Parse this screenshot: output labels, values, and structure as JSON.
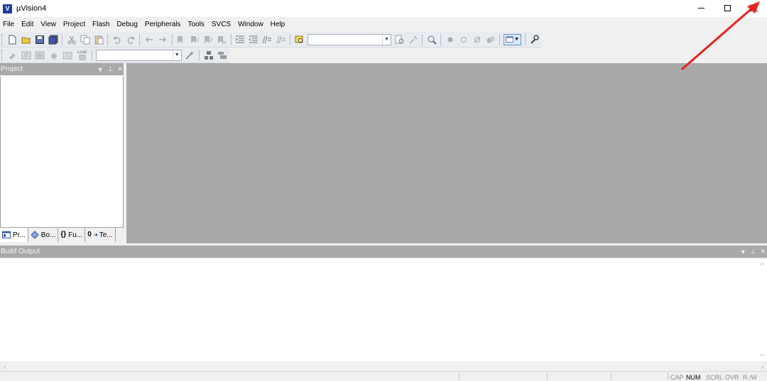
{
  "window": {
    "title": "µVision4",
    "app_icon_letter": "V"
  },
  "menu": [
    "File",
    "Edit",
    "View",
    "Project",
    "Flash",
    "Debug",
    "Peripherals",
    "Tools",
    "SVCS",
    "Window",
    "Help"
  ],
  "toolbar1": {
    "target_combo_value": ""
  },
  "toolbar2": {
    "build_target_value": "",
    "load_label": "Load"
  },
  "project_panel": {
    "title": "Project",
    "tabs": [
      {
        "label": "Pr...",
        "icon": "project-tab-icon"
      },
      {
        "label": "Bo...",
        "icon": "books-tab-icon"
      },
      {
        "label": "Fu...",
        "icon": "functions-tab-icon",
        "glyph": "{}"
      },
      {
        "label": "Te...",
        "icon": "templates-tab-icon",
        "glyph": "0"
      }
    ]
  },
  "build_output": {
    "title": "Build Output"
  },
  "statusbar": {
    "indicators": [
      "CAP",
      "NUM",
      "SCRL",
      "OVR",
      "R /W"
    ],
    "active": [
      "NUM"
    ]
  },
  "colors": {
    "panel_header": "#a9a9a9",
    "editor_bg": "#a9a9a9",
    "annotation_arrow": "#e8231f"
  }
}
